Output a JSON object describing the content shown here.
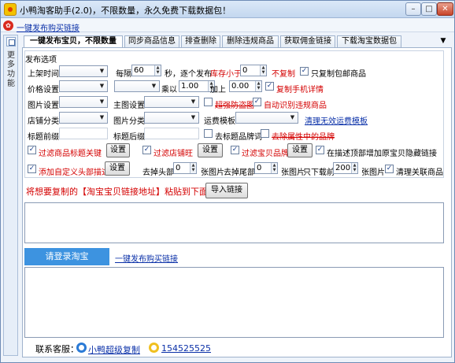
{
  "window": {
    "title": "小鸭淘客助手(2.0)，不限数量，永久免费下载数据包！",
    "min_label": "–",
    "max_label": "□",
    "close_label": "✕"
  },
  "top_link": "一键发布购买链接",
  "side_label": "更多功能",
  "tabs": [
    {
      "label": "一键发布宝贝，不限数量"
    },
    {
      "label": "同步商品信息"
    },
    {
      "label": "排查删除"
    },
    {
      "label": "删除违规商品"
    },
    {
      "label": "获取佣金链接"
    },
    {
      "label": "下载淘宝数据包"
    }
  ],
  "group_title": "发布选项",
  "row1": {
    "label": "上架时间",
    "interval_label": "每隔",
    "interval_value": "60",
    "seconds_label": "秒，逐个发布",
    "stock_label": "库存小于",
    "stock_value": "0",
    "no_copy_label": "不复制",
    "only_free_ship_label": "只复制包邮商品"
  },
  "row2": {
    "label": "价格设置",
    "multiply_label": "乘以",
    "multiply_value": "1.00",
    "add_label": "加上",
    "add_value": "0.00",
    "copy_mobile_label": "复制手机详情"
  },
  "row3": {
    "label": "图片设置",
    "main_img_label": "主图设置",
    "anti_theft_label": "超强防盗图",
    "auto_recognize_label": "自动识别违规商品"
  },
  "row4": {
    "label": "店铺分类",
    "img_category_label": "图片分类",
    "freight_label": "运费模板",
    "clear_freight_link": "清理无效运费模板"
  },
  "row5": {
    "prefix_label": "标题前缀",
    "suffix_label": "标题后缀",
    "remove_brand_label": "去标题品牌词",
    "remove_attr_brand_label": "去除属性中的品牌"
  },
  "row6": {
    "filter_title_label": "过滤商品标题关键",
    "filter_title_btn": "设置",
    "filter_shop_label": "过滤店铺旺",
    "filter_shop_btn": "设置",
    "filter_brand_label": "过滤宝贝品牌",
    "filter_brand_btn": "设置",
    "hidden_link_label": "在描述顶部增加原宝贝隐藏链接"
  },
  "row7": {
    "custom_header_label": "添加自定义头部描述",
    "custom_header_btn": "设置",
    "remove_head_label": "去掉头部",
    "remove_head_value": "0",
    "images_label_1": "张图片",
    "remove_tail_label": "去掉尾部",
    "remove_tail_value": "0",
    "images_label_2": "张图片",
    "download_only_label": "只下载前",
    "download_only_value": "200",
    "images_label_3": "张图片",
    "clean_related_label": "清理关联商品"
  },
  "paste_hint": "将想要复制的【淘宝宝贝链接地址】粘贴到下面！",
  "import_btn": "导入链接",
  "login_btn": "请登录淘宝",
  "publish_link": "一键发布购买链接",
  "footer": {
    "service_label": "联系客服：",
    "copy_link": "小鸭超级复制",
    "qq_number": "154525525"
  }
}
